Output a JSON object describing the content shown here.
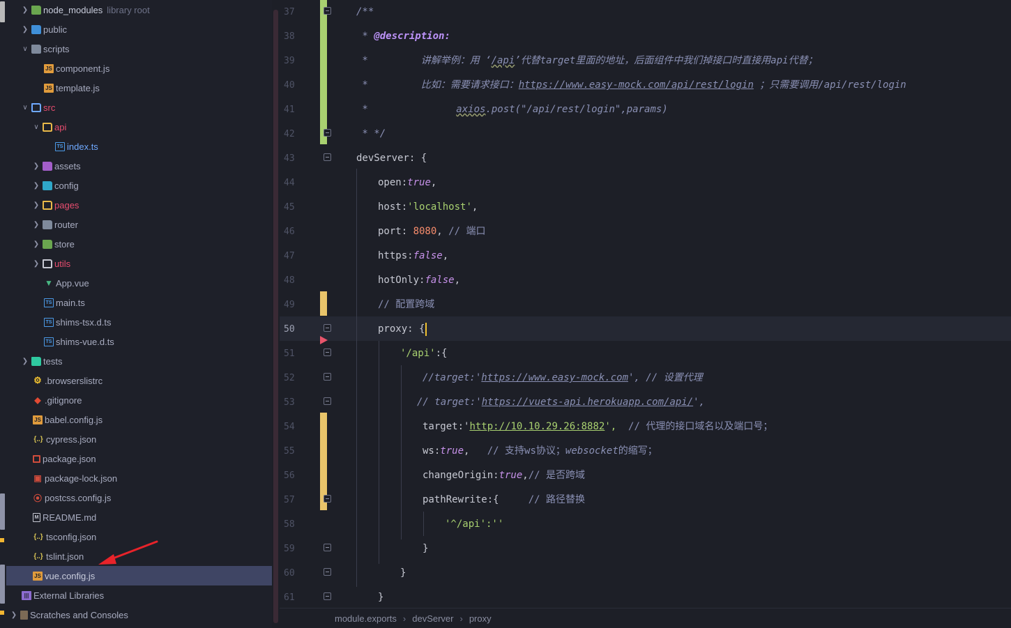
{
  "tree": {
    "items": [
      {
        "label": "node_modules",
        "hint": "library root"
      },
      {
        "label": "public"
      },
      {
        "label": "scripts"
      },
      {
        "label": "component.js"
      },
      {
        "label": "template.js"
      },
      {
        "label": "src"
      },
      {
        "label": "api"
      },
      {
        "label": "index.ts"
      },
      {
        "label": "assets"
      },
      {
        "label": "config"
      },
      {
        "label": "pages"
      },
      {
        "label": "router"
      },
      {
        "label": "store"
      },
      {
        "label": "utils"
      },
      {
        "label": "App.vue"
      },
      {
        "label": "main.ts"
      },
      {
        "label": "shims-tsx.d.ts"
      },
      {
        "label": "shims-vue.d.ts"
      },
      {
        "label": "tests"
      },
      {
        "label": ".browserslistrc"
      },
      {
        "label": ".gitignore"
      },
      {
        "label": "babel.config.js"
      },
      {
        "label": "cypress.json"
      },
      {
        "label": "package.json"
      },
      {
        "label": "package-lock.json"
      },
      {
        "label": "postcss.config.js"
      },
      {
        "label": "README.md"
      },
      {
        "label": "tsconfig.json"
      },
      {
        "label": "tslint.json"
      },
      {
        "label": "vue.config.js"
      },
      {
        "label": "External Libraries"
      },
      {
        "label": "Scratches and Consoles"
      }
    ]
  },
  "editor": {
    "line_numbers": [
      "37",
      "38",
      "39",
      "40",
      "41",
      "42",
      "43",
      "44",
      "45",
      "46",
      "47",
      "48",
      "49",
      "50",
      "51",
      "52",
      "53",
      "54",
      "55",
      "56",
      "57",
      "58",
      "59",
      "60",
      "61"
    ],
    "code": {
      "l37": "/**",
      "l38a": " * ",
      "l38b": "@description:",
      "l39a": " *         讲解举例：用 ‘",
      "l39b": "/api",
      "l39c": "’代替target里面的地址，后面组件中我们掉接口时直接用api代替；",
      "l40a": " *         比如：需要请求接口：",
      "l40b": "https://www.easy-mock.com/api/rest/login",
      "l40c": " ；只需要调用/api/rest/login",
      "l41a": " *               ",
      "l41b": "axios",
      "l41c": ".post(\"/api/rest/login\",params)",
      "l42": " * */",
      "l43": "devServer: {",
      "l44a": "open:",
      "l44b": "true",
      "l44c": ",",
      "l45a": "host:",
      "l45b": "'localhost'",
      "l45c": ",",
      "l46a": "port: ",
      "l46b": "8080",
      "l46c": ", ",
      "l46d": "// 端口",
      "l47a": "https:",
      "l47b": "false",
      "l47c": ",",
      "l48a": "hotOnly:",
      "l48b": "false",
      "l48c": ",",
      "l49": "// 配置跨域",
      "l50a": "proxy: ",
      "l50b": "{",
      "l51a": "'/api'",
      "l51b": ":{",
      "l52a": "//target:'",
      "l52b": "https://www.easy-mock.com",
      "l52c": "', // 设置代理",
      "l53a": "// target:'",
      "l53b": "https://vuets-api.herokuapp.com/api/",
      "l53c": "',",
      "l54a": "target:'",
      "l54b": "http://10.10.29.26:8882",
      "l54c": "',",
      "l54d": "  // 代理的接口域名以及端口号；",
      "l55a": "ws:",
      "l55b": "true",
      "l55c": ",",
      "l55d": "   // 支持ws协议；",
      "l55e": "websocket",
      "l55f": "的缩写；",
      "l56a": "changeOrigin:",
      "l56b": "true",
      "l56c": ",",
      "l56d": "// 是否跨域",
      "l57a": "pathRewrite:{",
      "l57b": "     // 路径替换",
      "l58": "'^/api':''",
      "l59": "}",
      "l60": "}",
      "l61": "}"
    }
  },
  "breadcrumb": [
    "module.exports",
    "devServer",
    "proxy"
  ],
  "colors": {
    "background": "#1d1f27",
    "selection": "#3f4564",
    "change_added": "#a9d170",
    "change_modified": "#e9c46a",
    "annotation_arrow": "#e8232a"
  }
}
